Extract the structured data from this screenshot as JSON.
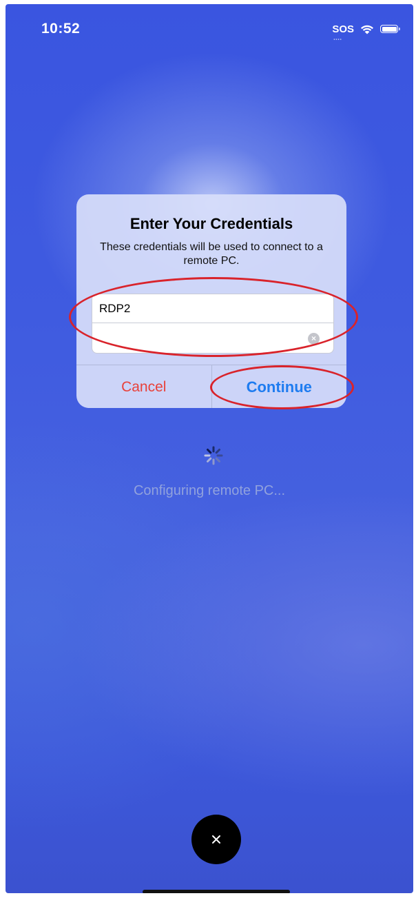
{
  "status_bar": {
    "time": "10:52",
    "sos": "SOS"
  },
  "alert": {
    "title": "Enter Your Credentials",
    "message": "These credentials will be used to connect to a remote PC.",
    "username_value": "RDP2",
    "password_value": "",
    "cancel_label": "Cancel",
    "continue_label": "Continue"
  },
  "loading": {
    "text": "Configuring remote PC..."
  },
  "close_button": {
    "label": "×"
  },
  "colors": {
    "background_blue": "#3f5be0",
    "cancel_red": "#e8413a",
    "continue_blue": "#1e7cf0",
    "annotation_red": "#d9232b"
  },
  "icons": [
    "wifi-icon",
    "battery-icon",
    "clear-icon",
    "spinner-icon",
    "close-icon"
  ]
}
